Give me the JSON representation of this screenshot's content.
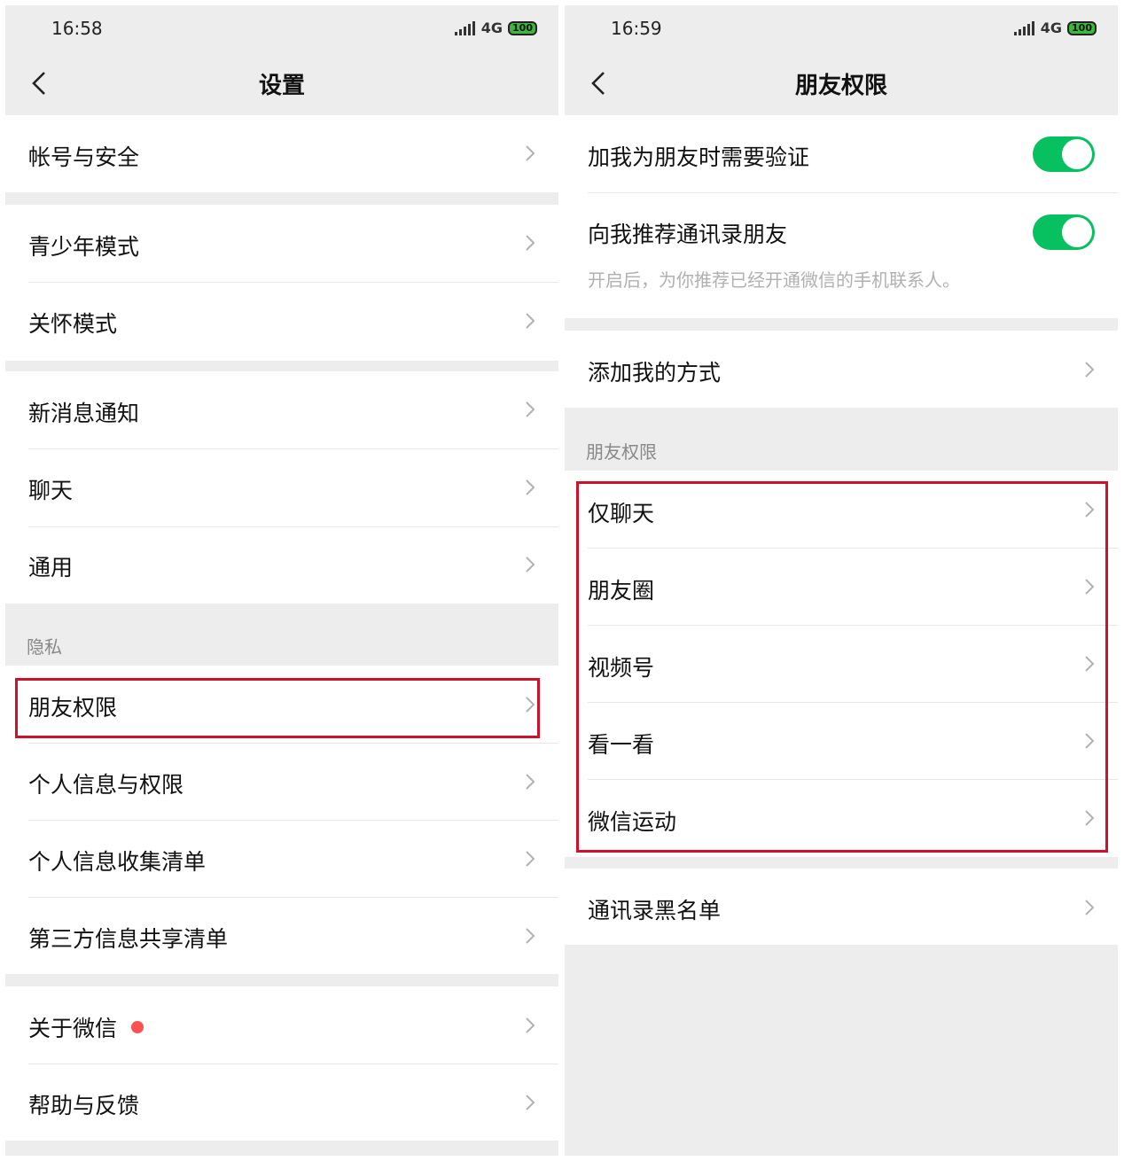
{
  "left_screen": {
    "status": {
      "time": "16:58",
      "network": "4G",
      "battery": "100"
    },
    "title": "设置",
    "items": {
      "account_security": "帐号与安全",
      "youth_mode": "青少年模式",
      "care_mode": "关怀模式",
      "new_msg_notify": "新消息通知",
      "chat": "聊天",
      "general": "通用",
      "friend_permissions": "朋友权限",
      "personal_info_permissions": "个人信息与权限",
      "personal_info_collection": "个人信息收集清单",
      "third_party_sharing": "第三方信息共享清单",
      "about_wechat": "关于微信",
      "help_feedback": "帮助与反馈"
    },
    "sections": {
      "privacy": "隐私"
    }
  },
  "right_screen": {
    "status": {
      "time": "16:59",
      "network": "4G",
      "battery": "100"
    },
    "title": "朋友权限",
    "toggles": {
      "verify_on_add": {
        "label": "加我为朋友时需要验证",
        "on": true
      },
      "recommend_contacts": {
        "label": "向我推荐通讯录朋友",
        "on": true,
        "desc": "开启后，为你推荐已经开通微信的手机联系人。"
      }
    },
    "items": {
      "add_methods": "添加我的方式",
      "chat_only": "仅聊天",
      "moments": "朋友圈",
      "channels": "视频号",
      "top_stories": "看一看",
      "wechat_sports": "微信运动",
      "contacts_blacklist": "通讯录黑名单"
    },
    "sections": {
      "friend_permissions": "朋友权限"
    }
  },
  "colors": {
    "toggle_on": "#07c160",
    "highlight": "#d0112b",
    "badge": "#fa5151",
    "background": "#ededed"
  },
  "icons": [
    "back-arrow-icon",
    "chevron-right-icon",
    "signal-icon",
    "battery-icon"
  ]
}
